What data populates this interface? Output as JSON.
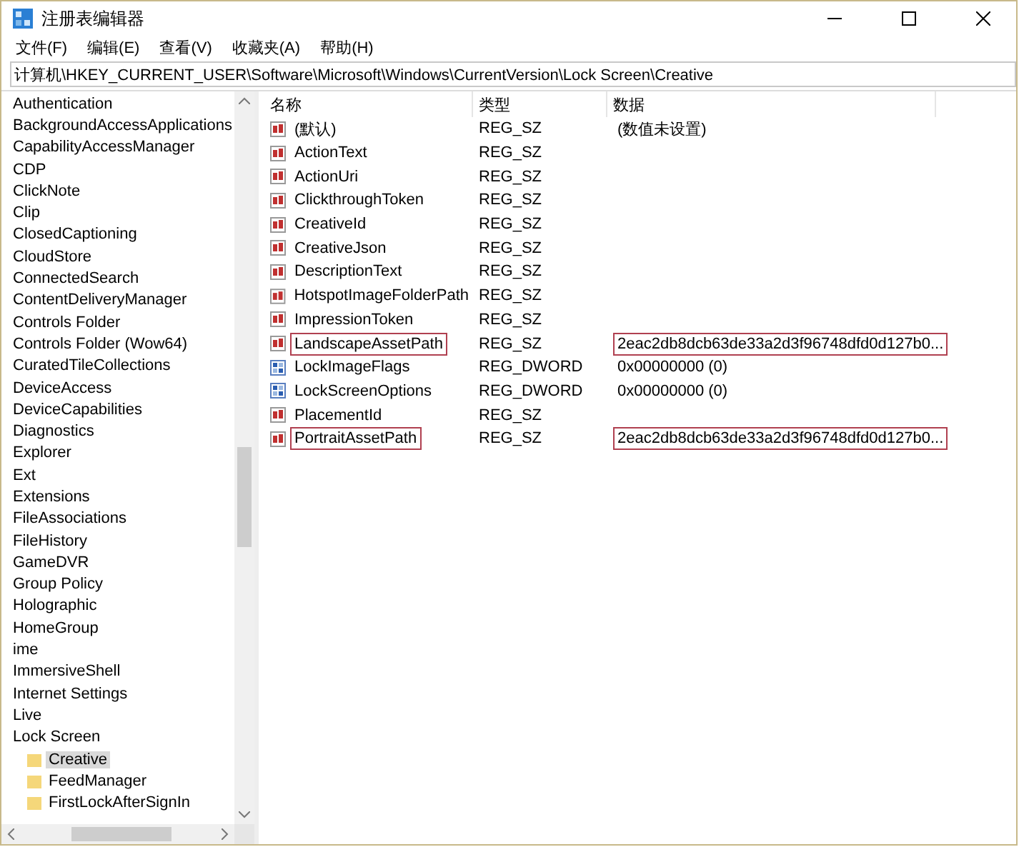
{
  "window": {
    "title": "注册表编辑器"
  },
  "menu": [
    "文件(F)",
    "编辑(E)",
    "查看(V)",
    "收藏夹(A)",
    "帮助(H)"
  ],
  "address": "计算机\\HKEY_CURRENT_USER\\Software\\Microsoft\\Windows\\CurrentVersion\\Lock Screen\\Creative",
  "tree": [
    {
      "label": "Authentication",
      "selected": false
    },
    {
      "label": "BackgroundAccessApplications",
      "selected": false
    },
    {
      "label": "CapabilityAccessManager",
      "selected": false
    },
    {
      "label": "CDP",
      "selected": false
    },
    {
      "label": "ClickNote",
      "selected": false
    },
    {
      "label": "Clip",
      "selected": false
    },
    {
      "label": "ClosedCaptioning",
      "selected": false
    },
    {
      "label": "CloudStore",
      "selected": false
    },
    {
      "label": "ConnectedSearch",
      "selected": false
    },
    {
      "label": "ContentDeliveryManager",
      "selected": false
    },
    {
      "label": "Controls Folder",
      "selected": false
    },
    {
      "label": "Controls Folder (Wow64)",
      "selected": false
    },
    {
      "label": "CuratedTileCollections",
      "selected": false
    },
    {
      "label": "DeviceAccess",
      "selected": false
    },
    {
      "label": "DeviceCapabilities",
      "selected": false
    },
    {
      "label": "Diagnostics",
      "selected": false
    },
    {
      "label": "Explorer",
      "selected": false
    },
    {
      "label": "Ext",
      "selected": false
    },
    {
      "label": "Extensions",
      "selected": false
    },
    {
      "label": "FileAssociations",
      "selected": false
    },
    {
      "label": "FileHistory",
      "selected": false
    },
    {
      "label": "GameDVR",
      "selected": false
    },
    {
      "label": "Group Policy",
      "selected": false
    },
    {
      "label": "Holographic",
      "selected": false
    },
    {
      "label": "HomeGroup",
      "selected": false
    },
    {
      "label": "ime",
      "selected": false
    },
    {
      "label": "ImmersiveShell",
      "selected": false
    },
    {
      "label": "Internet Settings",
      "selected": false
    },
    {
      "label": "Live",
      "selected": false
    },
    {
      "label": "Lock Screen",
      "selected": false,
      "children": [
        {
          "label": "Creative",
          "selected": true
        },
        {
          "label": "FeedManager",
          "selected": false
        },
        {
          "label": "FirstLockAfterSignIn",
          "selected": false
        }
      ]
    }
  ],
  "columns": [
    "名称",
    "类型",
    "数据"
  ],
  "values": [
    {
      "kind": "string",
      "name": "(默认)",
      "type": "REG_SZ",
      "data": "(数值未设置)",
      "highlighted": false
    },
    {
      "kind": "string",
      "name": "ActionText",
      "type": "REG_SZ",
      "highlighted": false
    },
    {
      "kind": "string",
      "name": "ActionUri",
      "type": "REG_SZ",
      "highlighted": false
    },
    {
      "kind": "string",
      "name": "ClickthroughToken",
      "type": "REG_SZ",
      "highlighted": false
    },
    {
      "kind": "string",
      "name": "CreativeId",
      "type": "REG_SZ",
      "highlighted": false
    },
    {
      "kind": "string",
      "name": "CreativeJson",
      "type": "REG_SZ",
      "highlighted": false
    },
    {
      "kind": "string",
      "name": "DescriptionText",
      "type": "REG_SZ",
      "highlighted": false
    },
    {
      "kind": "string",
      "name": "HotspotImageFolderPath",
      "type": "REG_SZ",
      "highlighted": false
    },
    {
      "kind": "string",
      "name": "ImpressionToken",
      "type": "REG_SZ",
      "highlighted": false
    },
    {
      "kind": "string",
      "name": "LandscapeAssetPath",
      "type": "REG_SZ",
      "data": "2eac2db8dcb63de33a2d3f96748dfd0d127b0...",
      "highlighted": true
    },
    {
      "kind": "dword",
      "name": "LockImageFlags",
      "type": "REG_DWORD",
      "data": "0x00000000 (0)",
      "highlighted": false
    },
    {
      "kind": "dword",
      "name": "LockScreenOptions",
      "type": "REG_DWORD",
      "data": "0x00000000 (0)",
      "highlighted": false
    },
    {
      "kind": "string",
      "name": "PlacementId",
      "type": "REG_SZ",
      "highlighted": false
    },
    {
      "kind": "string",
      "name": "PortraitAssetPath",
      "type": "REG_SZ",
      "data": "2eac2db8dcb63de33a2d3f96748dfd0d127b0...",
      "highlighted": true
    }
  ]
}
